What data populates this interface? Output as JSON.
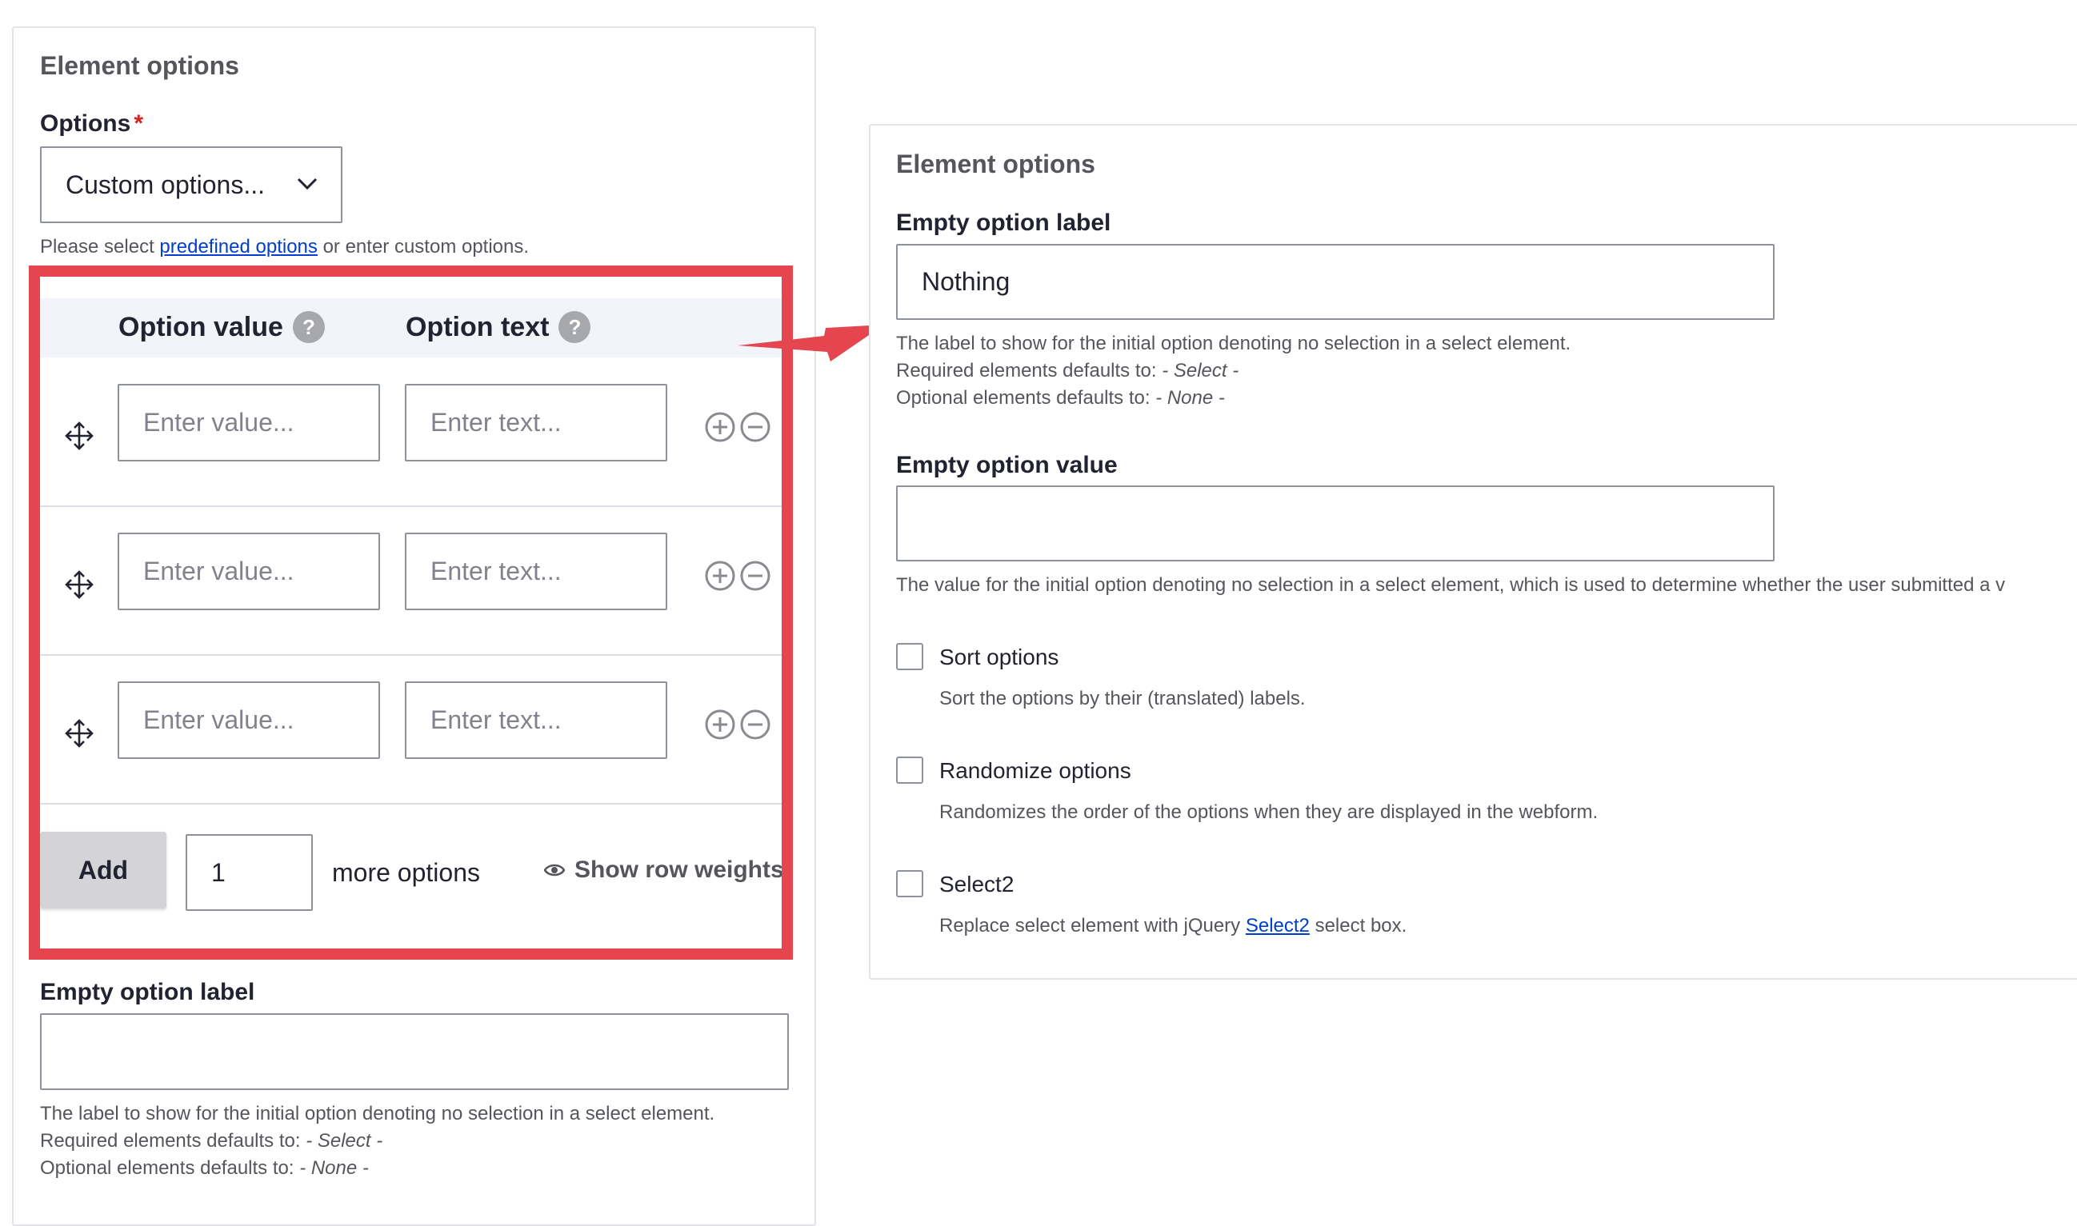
{
  "left_panel": {
    "title": "Element options",
    "options_label": "Options",
    "required_mark": "*",
    "select_value": "Custom options...",
    "help_prefix": "Please select ",
    "help_link": "predefined options",
    "help_suffix": " or enter custom options.",
    "table": {
      "col_value": "Option value",
      "col_text": "Option text",
      "help_glyph": "?",
      "rows": [
        {
          "value_placeholder": "Enter value...",
          "text_placeholder": "Enter text..."
        },
        {
          "value_placeholder": "Enter value...",
          "text_placeholder": "Enter text..."
        },
        {
          "value_placeholder": "Enter value...",
          "text_placeholder": "Enter text..."
        }
      ]
    },
    "add_button": "Add",
    "add_count": "1",
    "more_options": "more options",
    "show_row_weights": "Show row weights",
    "empty_label_title": "Empty option label",
    "empty_label_value": "",
    "empty_label_desc": "The label to show for the initial option denoting no selection in a select element.",
    "required_default_prefix": "Required elements defaults to: ",
    "required_default_value": "- Select -",
    "optional_default_prefix": "Optional elements defaults to: ",
    "optional_default_value": "- None -"
  },
  "right_panel": {
    "title": "Element options",
    "empty_label_title": "Empty option label",
    "empty_label_value": "Nothing",
    "empty_label_desc": "The label to show for the initial option denoting no selection in a select element.",
    "required_default_prefix": "Required elements defaults to: ",
    "required_default_value": "- Select -",
    "optional_default_prefix": "Optional elements defaults to: ",
    "optional_default_value": "- None -",
    "empty_value_title": "Empty option value",
    "empty_value_value": "",
    "empty_value_desc": "The value for the initial option denoting no selection in a select element, which is used to determine whether the user submitted a v",
    "sort_label": "Sort options",
    "sort_desc": "Sort the options by their (translated) labels.",
    "randomize_label": "Randomize options",
    "randomize_desc": "Randomizes the order of the options when they are displayed in the webform.",
    "select2_label": "Select2",
    "select2_desc_prefix": "Replace select element with jQuery ",
    "select2_link": "Select2",
    "select2_desc_suffix": " select box."
  },
  "colors": {
    "highlight": "#e5454e",
    "link": "#003ecc",
    "required": "#d72222"
  },
  "icons": [
    "chevron-down-icon",
    "help-icon",
    "drag-handle-icon",
    "add-row-icon",
    "remove-row-icon",
    "eye-icon",
    "arrow-annotation"
  ]
}
